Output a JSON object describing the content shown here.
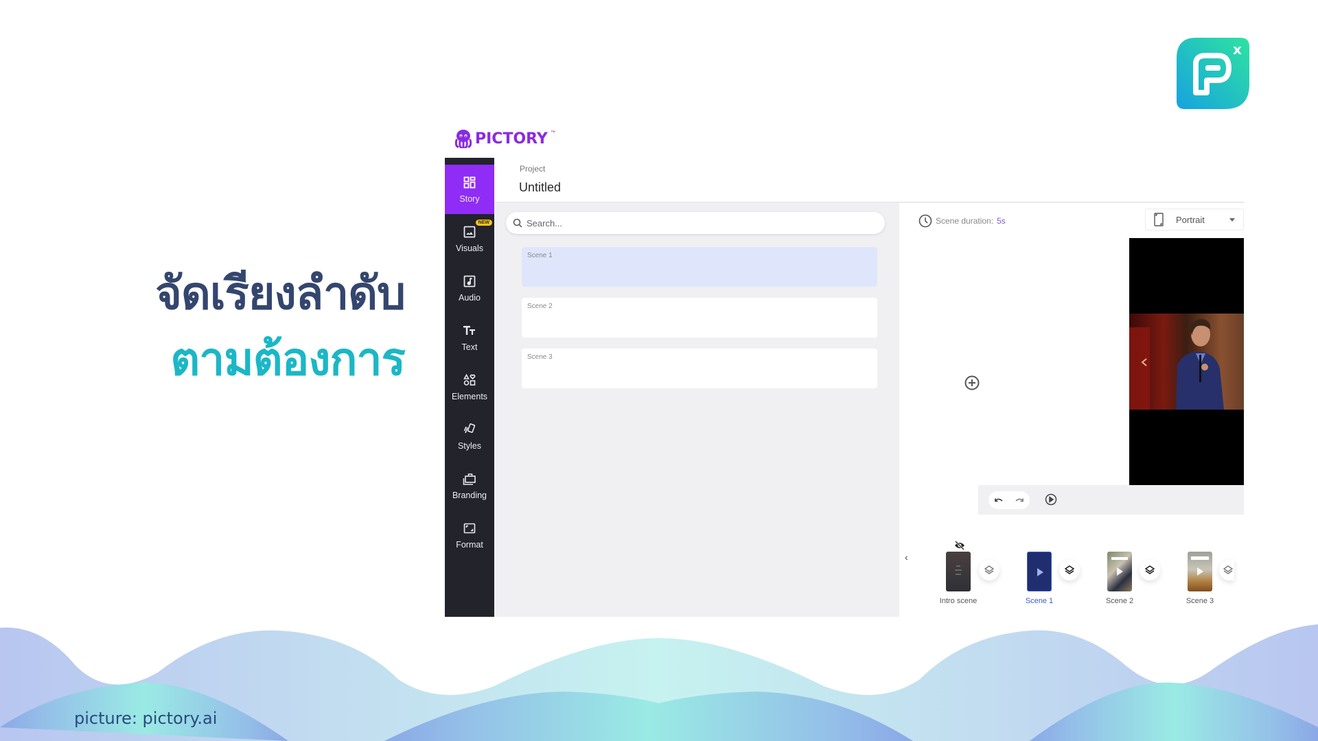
{
  "headline": {
    "line1": "จัดเรียงลำดับ",
    "line2": "ตามต้องการ"
  },
  "brand_logo": {
    "name": "px-logo",
    "letter": "P",
    "superscript": "x"
  },
  "credit": "picture: pictory.ai",
  "app": {
    "brand": {
      "name": "PICTORY",
      "tm": "™",
      "color": "#8a2be2"
    },
    "sidebar": {
      "items": [
        {
          "label": "Story",
          "icon": "grid-icon",
          "active": true
        },
        {
          "label": "Visuals",
          "icon": "image-icon",
          "badge": "NEW"
        },
        {
          "label": "Audio",
          "icon": "music-note-icon"
        },
        {
          "label": "Text",
          "icon": "text-icon"
        },
        {
          "label": "Elements",
          "icon": "shapes-icon"
        },
        {
          "label": "Styles",
          "icon": "styles-icon"
        },
        {
          "label": "Branding",
          "icon": "briefcase-icon"
        },
        {
          "label": "Format",
          "icon": "format-icon"
        }
      ]
    },
    "header": {
      "project_label": "Project",
      "project_title": "Untitled"
    },
    "search": {
      "placeholder": "Search..."
    },
    "scenes": [
      {
        "label": "Scene 1",
        "active": true
      },
      {
        "label": "Scene 2",
        "active": false
      },
      {
        "label": "Scene 3",
        "active": false
      }
    ],
    "scene_duration": {
      "label": "Scene duration:",
      "value": "5s"
    },
    "orientation": {
      "selected": "Portrait"
    },
    "timeline": {
      "items": [
        {
          "label": "Intro scene",
          "hidden": true
        },
        {
          "label": "Scene 1",
          "active": true
        },
        {
          "label": "Scene 2"
        },
        {
          "label": "Scene 3"
        }
      ]
    }
  },
  "colors": {
    "accent_purple": "#8f2cf5",
    "sidebar_bg": "#22232b",
    "headline_dark": "#34466e",
    "headline_teal": "#1bb7c6",
    "scene_active_bg": "#dfe6fc"
  }
}
